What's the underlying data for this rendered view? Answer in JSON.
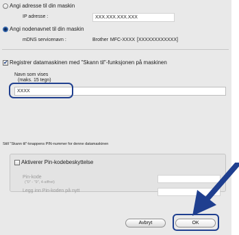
{
  "address_option": {
    "label": "Angi adresse til din maskin",
    "ip_label": "IP adresse :",
    "ip_placeholder": "XXX.XXX.XXX.XXX"
  },
  "nodename_option": {
    "label": "Angi nodenavnet til din maskin",
    "mdns_label": "mDNS servicenavn :",
    "mdns_value": "Brother MFC-XXXX  [XXXXXXXXXXXX]"
  },
  "scan_to": {
    "register_label": "Registrer datamaskinen med \"Skann til\"-funksjonen på maskinen",
    "display_name_label": "Navn som vises",
    "display_name_hint": "(maks. 15 tegn)",
    "display_name_value": "XXXX",
    "pin_section_label": "Still \"Skann til\"-knappens PIN-nummer for denne datamaskinen"
  },
  "pin": {
    "enable_label": "Aktiverer Pin-kodebeskyttelse",
    "pin_label": "Pin-kode",
    "pin_hint": "(\"0\" - \"9\", 4-siffret)",
    "reenter_label": "Legg inn Pin-koden på nytt"
  },
  "buttons": {
    "cancel": "Avbryt",
    "ok": "OK"
  },
  "icons": {
    "checkbox_mark": "✔"
  },
  "colors": {
    "callout_arrow": "#1f3f8f"
  }
}
